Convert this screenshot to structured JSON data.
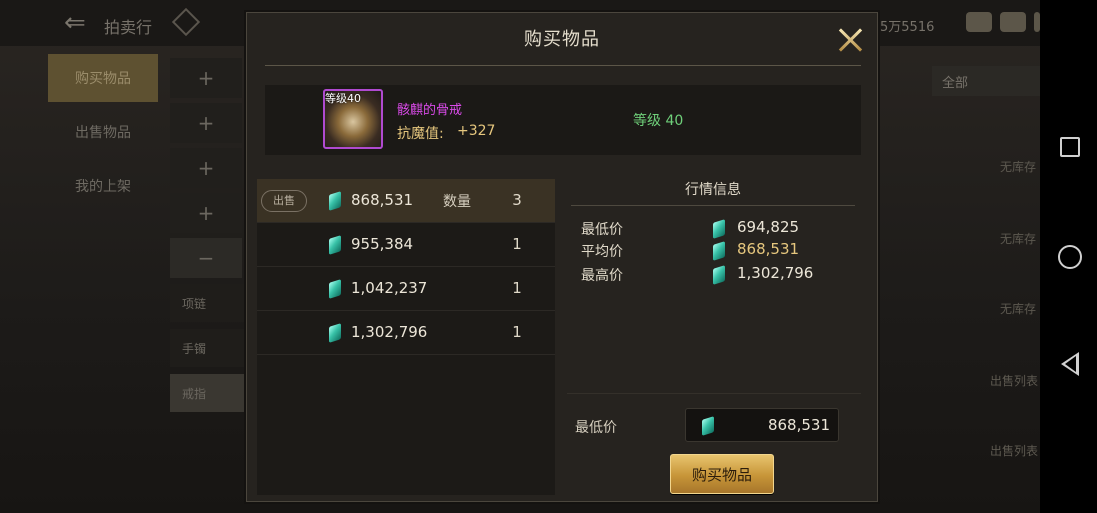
{
  "background": {
    "title": "拍卖行",
    "currency_text": "5万5516",
    "tabs": [
      "购买物品",
      "出售物品",
      "我的上架"
    ],
    "plus_buttons": [
      "+",
      "+",
      "+",
      "+"
    ],
    "minus_button": "−",
    "categories": [
      "项链",
      "手镯",
      "戒指"
    ],
    "filter_value": "全部",
    "side_texts": [
      "无库存",
      "无库存",
      "无库存",
      "出售列表",
      "出售列表"
    ]
  },
  "dialog": {
    "title": "购买物品",
    "item": {
      "level_tag": "等级40",
      "name": "骸麒的骨戒",
      "stat_label": "抗魔值:",
      "stat_value": "+327",
      "requirement": "等级 40"
    },
    "listings": {
      "sell_badge": "出售",
      "qty_label": "数量",
      "rows": [
        {
          "price": "868,531",
          "qty": "3",
          "selected": true
        },
        {
          "price": "955,384",
          "qty": "1",
          "selected": false
        },
        {
          "price": "1,042,237",
          "qty": "1",
          "selected": false
        },
        {
          "price": "1,302,796",
          "qty": "1",
          "selected": false
        }
      ]
    },
    "market": {
      "title": "行情信息",
      "lowest_label": "最低价",
      "lowest_value": "694,825",
      "average_label": "平均价",
      "average_value": "868,531",
      "highest_label": "最高价",
      "highest_value": "1,302,796"
    },
    "min_price": {
      "label": "最低价",
      "value": "868,531"
    },
    "buy_button": "购买物品"
  },
  "colors": {
    "item_name": "#d94ae8",
    "stat": "#e6c77e",
    "requirement": "#6fd07a",
    "gold_button": "#c79538"
  },
  "icons": {
    "currency": "green-gem-icon",
    "close": "close-x-icon",
    "back": "back-arrow-icon"
  }
}
